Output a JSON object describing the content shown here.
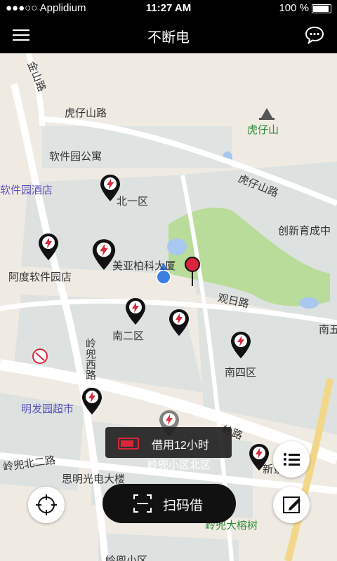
{
  "status_bar": {
    "carrier": "●●●○○ Applidium",
    "time": "11:27 AM",
    "battery": "100 %"
  },
  "nav": {
    "title": "不断电"
  },
  "map": {
    "roads": [
      "金山路",
      "虎仔山路",
      "虎仔山路",
      "观日路",
      "岭兜西路",
      "岭兜北二路",
      "岭路"
    ],
    "places": [
      {
        "name": "软件园公寓",
        "style": "dark"
      },
      {
        "name": "软件园酒店",
        "style": "purple"
      },
      {
        "name": "北一区",
        "style": "dark"
      },
      {
        "name": "虎仔山",
        "style": "green"
      },
      {
        "name": "创新育成中",
        "style": "dark"
      },
      {
        "name": "阿度软件园店",
        "style": "dark"
      },
      {
        "name": "美亚柏科大厦",
        "style": "dark"
      },
      {
        "name": "南二区",
        "style": "dark"
      },
      {
        "name": "南五",
        "style": "dark"
      },
      {
        "name": "南四区",
        "style": "dark"
      },
      {
        "name": "明发园超市",
        "style": "purple"
      },
      {
        "name": "思明光电大楼",
        "style": "dark"
      },
      {
        "name": "岭兜小区北区",
        "style": "white"
      },
      {
        "name": "新景",
        "style": "dark"
      },
      {
        "name": "岭兜大榕树",
        "style": "green"
      },
      {
        "name": "岭兜小区",
        "style": "dark"
      }
    ]
  },
  "toast": {
    "text": "借用12小时"
  },
  "actions": {
    "scan_label": "扫码借"
  },
  "colors": {
    "pin": "#111111",
    "bolt": "#d9263b",
    "park": "#b9dc9a",
    "water": "#a9c8ef"
  },
  "icons": [
    "menu-icon",
    "chat-icon",
    "locate-icon",
    "list-icon",
    "edit-icon",
    "scan-icon",
    "battery-icon",
    "power-bolt-icon"
  ]
}
